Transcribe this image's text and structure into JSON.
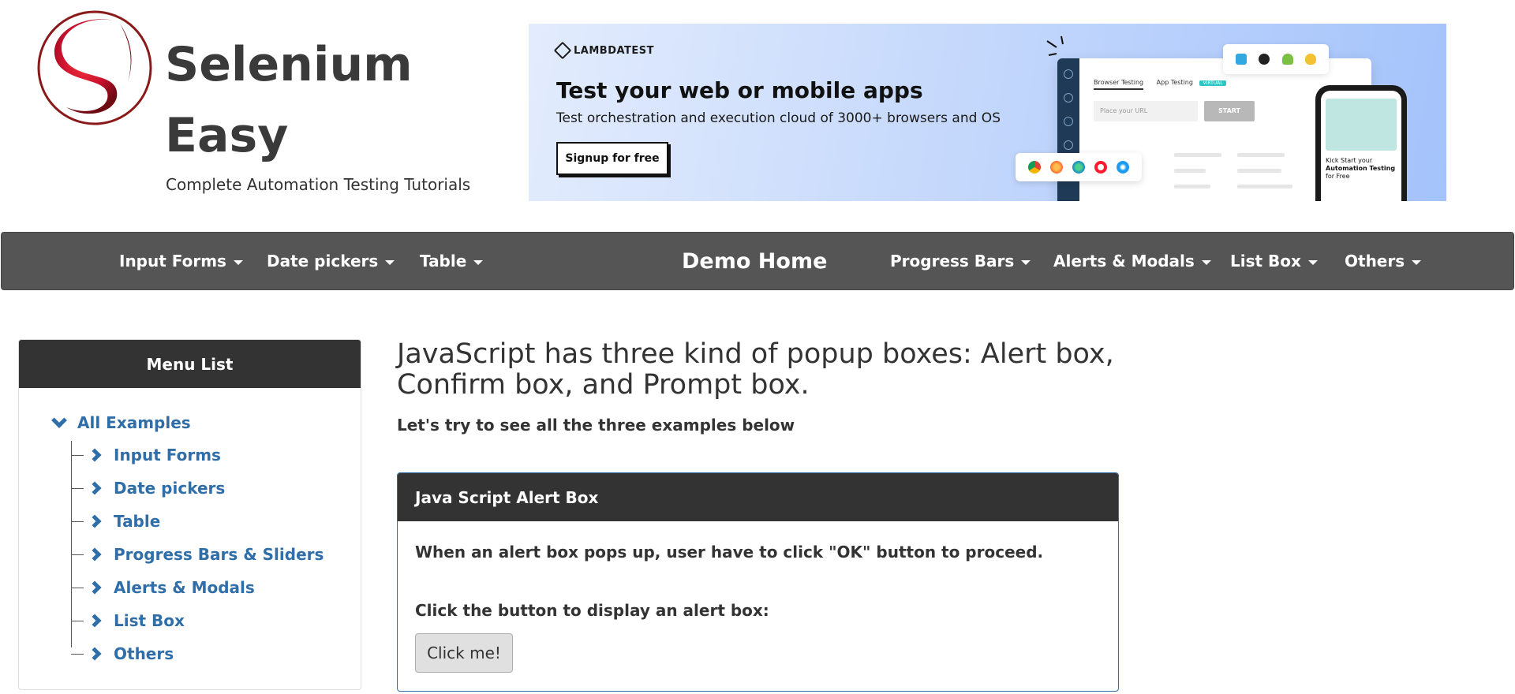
{
  "header": {
    "brand_line1": "Selenium",
    "brand_line2": "Easy",
    "tagline": "Complete Automation Testing Tutorials",
    "logo_color": "#c8102e"
  },
  "ad": {
    "brand": "LAMBDATEST",
    "headline": "Test your web or mobile apps",
    "subline": "Test orchestration and execution cloud of 3000+ browsers and OS",
    "cta_label": "Signup for free",
    "mock_tab_active": "Browser Testing",
    "mock_tab_other": "App Testing",
    "mock_tab_badge": "VIRTUAL",
    "mock_url_placeholder": "Place your URL",
    "mock_start_label": "START",
    "phone_text_line1": "Kick Start your",
    "phone_text_line2": "Automation Testing",
    "phone_text_line3": "for Free"
  },
  "nav": {
    "left": [
      "Input Forms",
      "Date pickers",
      "Table"
    ],
    "brand": "Demo Home",
    "right": [
      "Progress Bars",
      "Alerts & Modals",
      "List Box",
      "Others"
    ],
    "bg_color": "#555555"
  },
  "sidebar": {
    "title": "Menu List",
    "root": "All Examples",
    "items": [
      "Input Forms",
      "Date pickers",
      "Table",
      "Progress Bars & Sliders",
      "Alerts & Modals",
      "List Box",
      "Others"
    ],
    "link_color": "#2f6ea8"
  },
  "main": {
    "title": "JavaScript has three kind of popup boxes: Alert box, Confirm box, and Prompt box.",
    "subtitle": "Let's try to see all the three examples below",
    "panel": {
      "heading": "Java Script Alert Box",
      "description": "When an alert box pops up, user have to click \"OK\" button to proceed.",
      "instruction": "Click the button to display an alert box:",
      "button_label": "Click me!"
    }
  }
}
